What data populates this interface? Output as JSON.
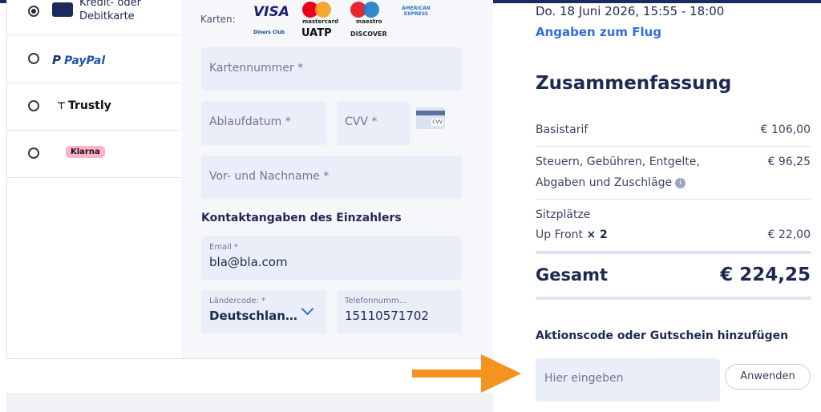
{
  "payment_methods": [
    {
      "label_line1": "Kredit- oder",
      "label_line2": "Debitkarte",
      "selected": true
    },
    {
      "label": "PayPal",
      "selected": false
    },
    {
      "label": "Trustly",
      "selected": false
    },
    {
      "label": "Klarna",
      "selected": false
    }
  ],
  "cards": {
    "label": "Karten:",
    "logos": [
      "VISA",
      "mastercard",
      "maestro",
      "AMERICAN EXPRESS",
      "Diners Club",
      "UATP",
      "DISCOVER"
    ]
  },
  "form": {
    "card_number_placeholder": "Kartennummer *",
    "expiry_placeholder": "Ablaufdatum *",
    "cvv_placeholder": "CVV *",
    "cvv_icon_text": "CVV",
    "name_placeholder": "Vor- und Nachname *",
    "contact_title": "Kontaktangaben des Einzahlers",
    "email_label": "Email *",
    "email_value": "bla@bla.com",
    "country_label": "Ländercode: *",
    "country_value": "Deutschlan…",
    "phone_label": "Telefonnumm…",
    "phone_value": "15110571702"
  },
  "flight": {
    "datetime": "Do. 18 Juni 2026, 15:55 - 18:00",
    "details_link": "Angaben zum Flug"
  },
  "summary": {
    "title": "Zusammenfassung",
    "base_label": "Basistarif",
    "base_value": "€ 106,00",
    "taxes_line1": "Steuern, Gebühren, Entgelte,",
    "taxes_line2": "Abgaben und Zuschläge",
    "taxes_value": "€ 96,25",
    "seats_label": "Sitzplätze",
    "upfront_label": "Up Front",
    "upfront_qty": "× 2",
    "upfront_value": "€ 22,00",
    "total_label": "Gesamt",
    "total_value": "€ 224,25"
  },
  "promo": {
    "title": "Aktionscode oder Gutschein hinzufügen",
    "placeholder": "Hier eingeben",
    "apply_label": "Anwenden"
  },
  "colors": {
    "navy": "#1c2a52",
    "link": "#2f6fd6",
    "field_bg": "#e9eef8",
    "arrow": "#f5931f"
  }
}
